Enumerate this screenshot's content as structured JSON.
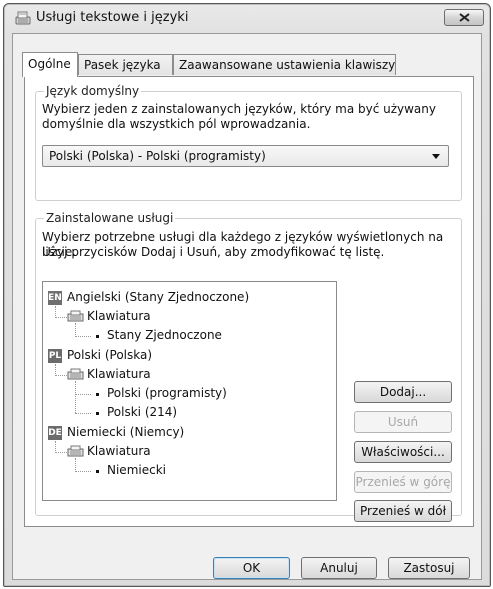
{
  "window": {
    "title": "Usługi tekstowe i języki"
  },
  "icons": {
    "app": "text-services-icon",
    "close": "close-icon",
    "keyboard": "keyboard-icon"
  },
  "tabs": [
    {
      "label": "Ogólne",
      "active": true
    },
    {
      "label": "Pasek języka",
      "active": false
    },
    {
      "label": "Zaawansowane ustawienia klawiszy",
      "active": false
    }
  ],
  "default_language": {
    "legend": "Język domyślny",
    "description_line1": "Wybierz jeden z zainstalowanych języków, który ma być używany",
    "description_line2": "domyślnie dla wszystkich pól wprowadzania.",
    "selected": "Polski (Polska) - Polski (programisty)"
  },
  "installed_services": {
    "legend": "Zainstalowane usługi",
    "description_line1": "Wybierz potrzebne usługi dla każdego z języków wyświetlonych na liście.",
    "description_line2": "Użyj przycisków Dodaj i Usuń, aby zmodyfikować tę listę.",
    "tree": {
      "en": {
        "badge": "EN",
        "label": "Angielski (Stany Zjednoczone)",
        "keyboard_label": "Klawiatura",
        "layouts": [
          "Stany Zjednoczone"
        ]
      },
      "pl": {
        "badge": "PL",
        "label": "Polski (Polska)",
        "keyboard_label": "Klawiatura",
        "layouts": [
          "Polski (programisty)",
          "Polski (214)"
        ]
      },
      "de": {
        "badge": "DE",
        "label": "Niemiecki (Niemcy)",
        "keyboard_label": "Klawiatura",
        "layouts": [
          "Niemiecki"
        ]
      }
    },
    "buttons": {
      "add": "Dodaj...",
      "remove": "Usuń",
      "properties": "Właściwości...",
      "move_up": "Przenieś w górę",
      "move_down": "Przenieś w dół"
    }
  },
  "footer": {
    "ok": "OK",
    "cancel": "Anuluj",
    "apply": "Zastosuj"
  }
}
